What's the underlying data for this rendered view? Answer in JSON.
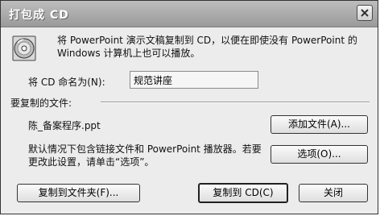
{
  "window": {
    "title": "打包成 CD",
    "close_label": "×"
  },
  "description": "将 PowerPoint 演示文稿复制到 CD，以便在即使没有 PowerPoint 的 Windows 计算机上也可以播放。",
  "cd_name": {
    "label": "将 CD 命名为(N):",
    "value": "规范讲座"
  },
  "files": {
    "section_label": "要复制的文件:",
    "file_name": "陈_备案程序.ppt",
    "add_button": "添加文件(A)..."
  },
  "options": {
    "text": "默认情况下包含链接文件和 PowerPoint 播放器。若要更改此设置，请单击“选项”。",
    "button": "选项(O)..."
  },
  "footer": {
    "copy_to_folder": "复制到文件夹(F)...",
    "copy_to_cd": "复制到 CD(C)",
    "close": "关闭"
  },
  "icons": {
    "cd": "cd-disc-icon",
    "close": "close-icon"
  }
}
